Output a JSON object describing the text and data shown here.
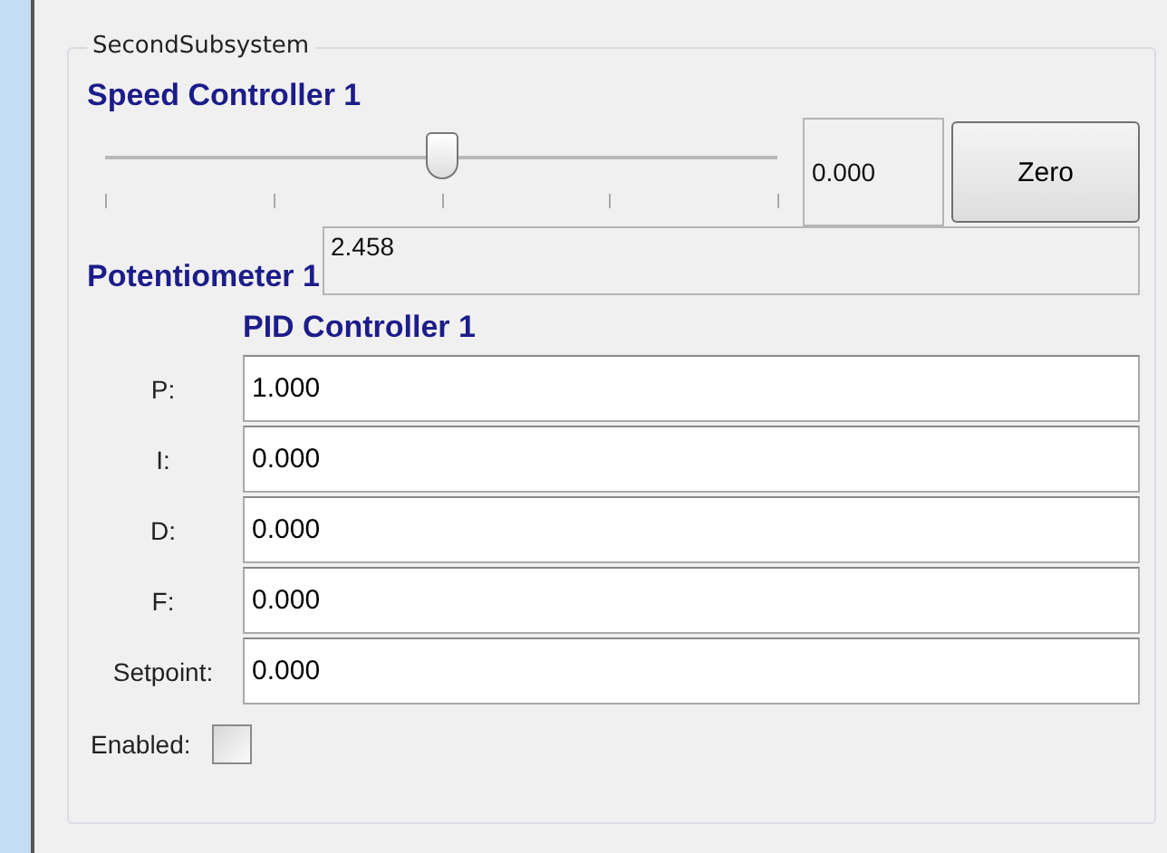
{
  "group": {
    "title": "SecondSubsystem"
  },
  "speed_controller": {
    "title": "Speed Controller 1",
    "level": 0.5,
    "value": "0.000",
    "button": "Zero"
  },
  "potentiometer": {
    "label": "Potentiometer 1",
    "value": "2.458"
  },
  "pid": {
    "title": "PID Controller 1",
    "fields": [
      {
        "label": "P:",
        "value": "1.000"
      },
      {
        "label": "I:",
        "value": "0.000"
      },
      {
        "label": "D:",
        "value": "0.000"
      },
      {
        "label": "F:",
        "value": "0.000"
      },
      {
        "label": "Setpoint:",
        "value": "0.000"
      }
    ],
    "enabled": {
      "label": "Enabled:",
      "checked": false
    }
  }
}
